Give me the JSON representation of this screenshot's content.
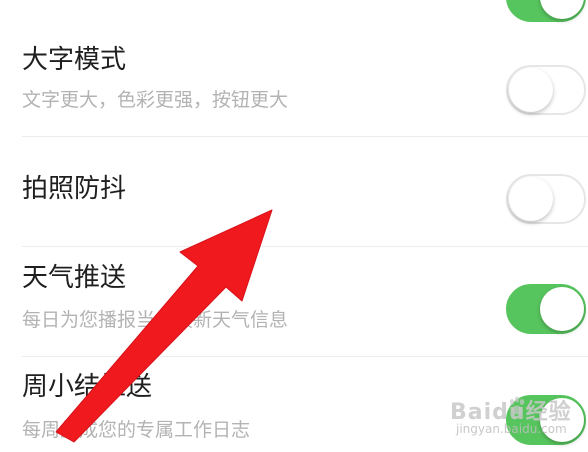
{
  "settings": {
    "items": [
      {
        "title": "",
        "subtitle": "",
        "enabled": true
      },
      {
        "title": "大字模式",
        "subtitle": "文字更大，色彩更强，按钮更大",
        "enabled": false
      },
      {
        "title": "拍照防抖",
        "subtitle": "",
        "enabled": false
      },
      {
        "title": "天气推送",
        "subtitle": "每日为您播报当日最新天气信息",
        "enabled": true
      },
      {
        "title": "周小结推送",
        "subtitle": "每周生成您的专属工作日志",
        "enabled": true
      }
    ]
  },
  "colors": {
    "toggle_on": "#57c55e",
    "toggle_off_border": "#e6e6e6",
    "annotation_arrow": "#f0191e"
  },
  "annotation": {
    "icon": "red-arrow-icon",
    "points_to": "拍照防抖"
  },
  "watermark": {
    "logo_text": "Baidu经验",
    "url": "jingyan.baidu.com"
  }
}
